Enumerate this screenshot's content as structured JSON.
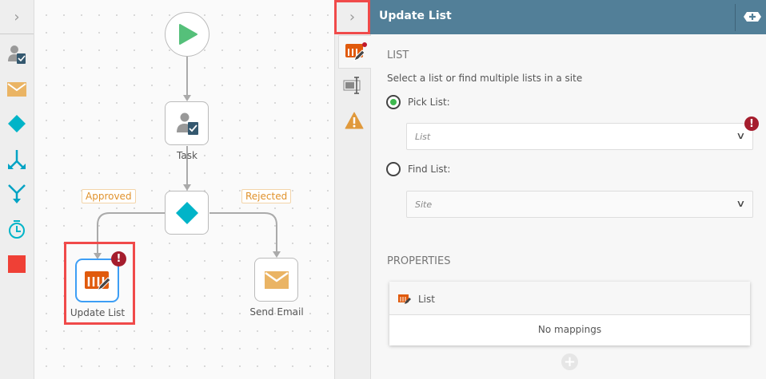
{
  "toolbar": {
    "expand_icon": "chevron-right",
    "tools": [
      "task-icon",
      "email-icon",
      "decision-icon",
      "split-icon",
      "merge-icon",
      "timer-icon",
      "stop-icon"
    ]
  },
  "canvas": {
    "nodes": {
      "task": "Task",
      "update_list": "Update List",
      "send_email": "Send Email"
    },
    "branches": {
      "approved": "Approved",
      "rejected": "Rejected"
    },
    "error_mark": "!"
  },
  "panel": {
    "title": "Update List",
    "list_section": "LIST",
    "instruction": "Select a list or find multiple lists in a site",
    "pick_list_label": "Pick List:",
    "list_placeholder": "List",
    "find_list_label": "Find List:",
    "site_placeholder": "Site",
    "properties_section": "PROPERTIES",
    "property_name": "List",
    "no_mappings": "No mappings",
    "error_mark": "!"
  },
  "colors": {
    "header": "#527f98",
    "accent_orange": "#e05a0c",
    "error": "#a51d2d",
    "teal": "#00b4c8",
    "highlight": "#f04a4a"
  }
}
